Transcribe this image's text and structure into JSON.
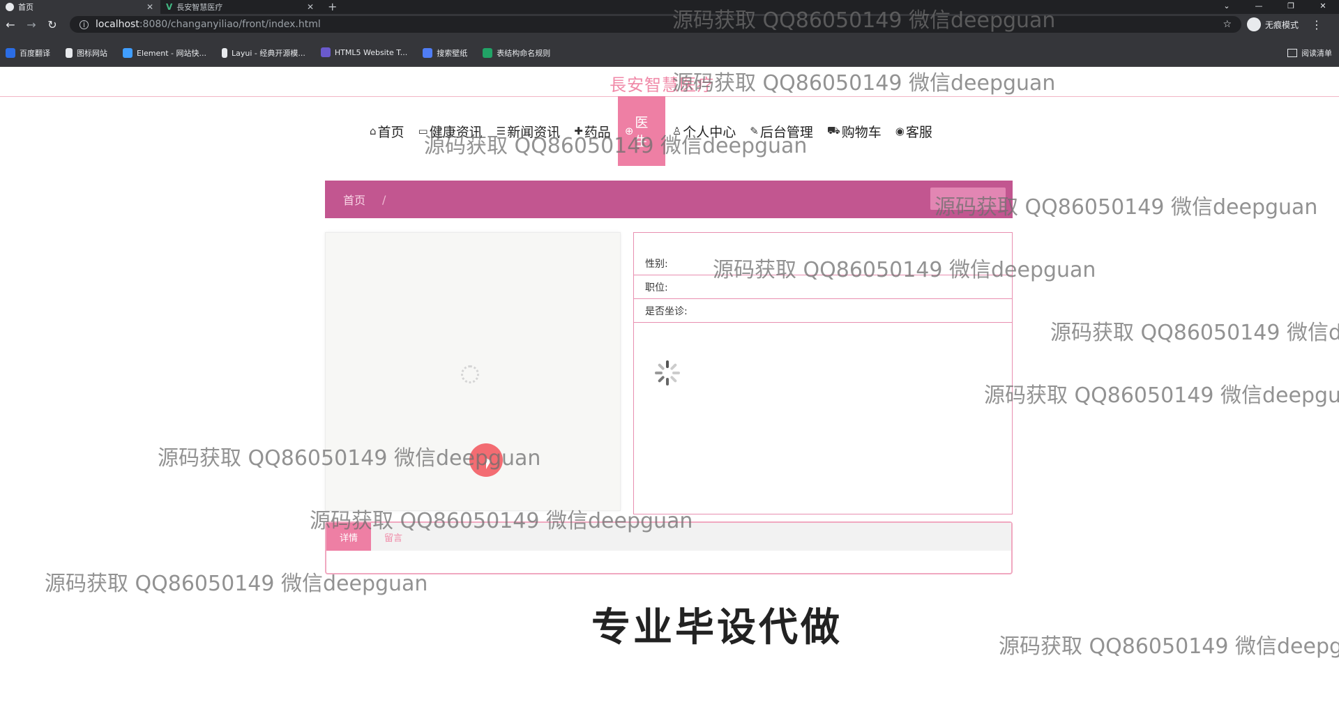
{
  "browser": {
    "tabs": [
      {
        "title": "首页",
        "active": true,
        "icon": "globe-icon"
      },
      {
        "title": "長安智慧医疗",
        "active": false,
        "icon": "vue-icon"
      }
    ],
    "url_host": "localhost",
    "url_path": ":8080/changanyiliao/front/index.html",
    "incognito_label": "无痕模式",
    "bookmarks": [
      {
        "label": "百度翻译",
        "color": "#2b6de5"
      },
      {
        "label": "图标网站",
        "color": "#e8eaed"
      },
      {
        "label": "Element - 网站快...",
        "color": "#409eff"
      },
      {
        "label": "Layui - 经典开源模...",
        "color": "#e8eaed"
      },
      {
        "label": "HTML5 Website T...",
        "color": "#6a5acd"
      },
      {
        "label": "搜索壁纸",
        "color": "#4f7df5"
      },
      {
        "label": "表结构命名规则",
        "color": "#21a366"
      }
    ],
    "reading_list": "阅读清单"
  },
  "site": {
    "brand": "長安智慧医疗",
    "nav": [
      {
        "label": "首页",
        "icon": "⌂"
      },
      {
        "label": "健康资讯",
        "icon": "▭"
      },
      {
        "label": "新闻资讯",
        "icon": "☰"
      },
      {
        "label": "药品",
        "icon": "✚"
      },
      {
        "label": "医生",
        "icon": "⊕",
        "active": true
      },
      {
        "label": "个人中心",
        "icon": "♙"
      },
      {
        "label": "后台管理",
        "icon": "✎"
      },
      {
        "label": "购物车",
        "icon": "⛟"
      },
      {
        "label": "客服",
        "icon": "◉"
      }
    ],
    "breadcrumb": {
      "home": "首页",
      "separator": "/"
    },
    "info_rows": [
      "性别:",
      "职位:",
      "是否坐诊:"
    ],
    "detail_tabs": [
      "详情",
      "留言"
    ],
    "accent_color": "#ee7fa4",
    "breadcrumb_color": "#c25690"
  },
  "overlay": {
    "watermark": "源码获取 QQ86050149 微信deepguan",
    "caption": "专业毕设代做"
  }
}
